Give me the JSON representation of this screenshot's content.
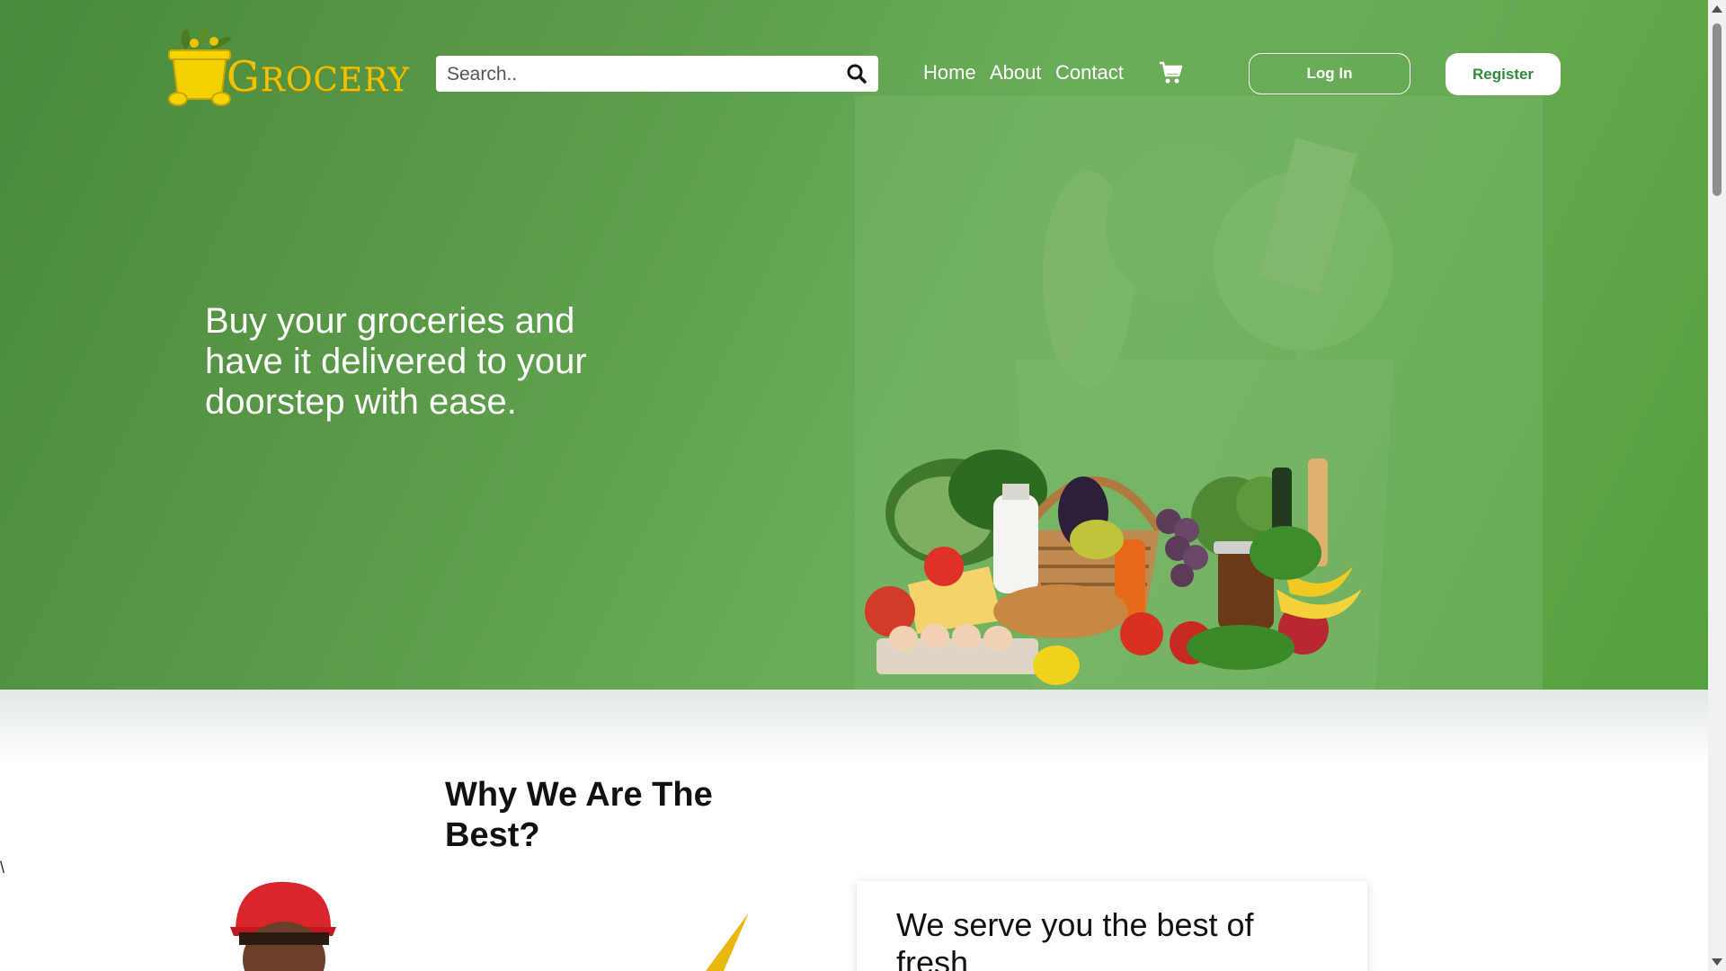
{
  "brand": {
    "name_first": "G",
    "name_rest": "ROCERY",
    "logo_icon": "grocery-bag-icon",
    "color": "#f4c100"
  },
  "search": {
    "placeholder": "Search..",
    "value": "",
    "icon": "search-icon"
  },
  "nav": {
    "links": [
      {
        "label": "Home"
      },
      {
        "label": "About"
      },
      {
        "label": "Contact"
      }
    ],
    "cart_icon": "cart-icon",
    "login_label": "Log In",
    "register_label": "Register"
  },
  "hero": {
    "text": "Buy your groceries and have it delivered to your doorstep with ease.",
    "colors": {
      "green_dark": "#4a8a3c",
      "green_light": "#6aad58"
    }
  },
  "why": {
    "title": "Why We Are The Best?",
    "stray_char": "\\",
    "card_text": "We serve you the best of fresh"
  }
}
